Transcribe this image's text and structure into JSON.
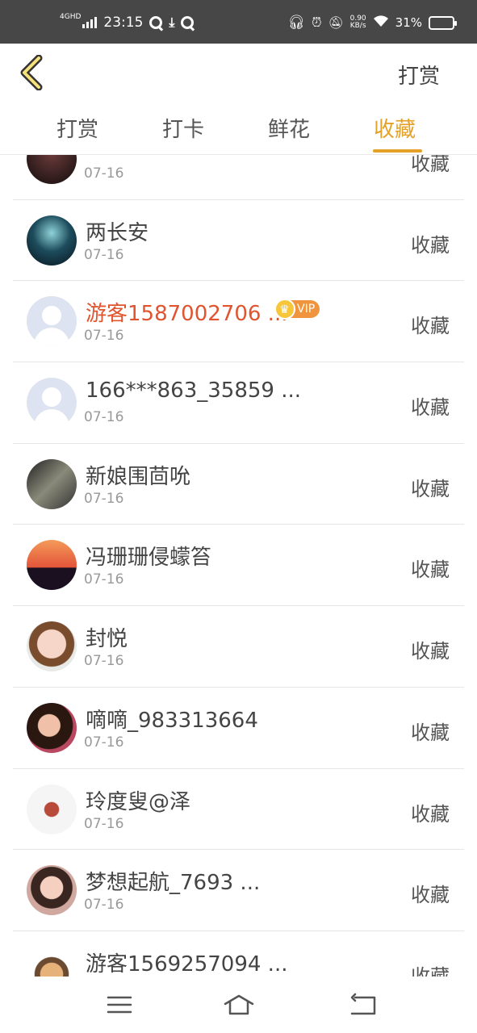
{
  "status_bar": {
    "network": "4GHD",
    "time": "23:15",
    "speed_value": "0.90",
    "speed_unit": "KB/s",
    "battery": "31%",
    "battery_level": 0.31
  },
  "header": {
    "action_label": "打赏"
  },
  "tabs": [
    {
      "label": "打赏"
    },
    {
      "label": "打卡"
    },
    {
      "label": "鲜花"
    },
    {
      "label": "收藏"
    }
  ],
  "active_tab": 3,
  "list": {
    "items": [
      {
        "name": "",
        "date": "07-16",
        "action": "收藏"
      },
      {
        "name": "两长安",
        "date": "07-16",
        "action": "收藏"
      },
      {
        "name": "游客1587002706 ...",
        "date": "07-16",
        "action": "收藏",
        "vip": "VIP"
      },
      {
        "name": "166***863_35859 ...",
        "date": "07-16",
        "action": "收藏"
      },
      {
        "name": "新娘围茴吮",
        "date": "07-16",
        "action": "收藏"
      },
      {
        "name": "冯珊珊侵蠓笞",
        "date": "07-16",
        "action": "收藏"
      },
      {
        "name": "封悦",
        "date": "07-16",
        "action": "收藏"
      },
      {
        "name": "嘀嘀_983313664",
        "date": "07-16",
        "action": "收藏"
      },
      {
        "name": "玲度叟@泽",
        "date": "07-16",
        "action": "收藏"
      },
      {
        "name": "梦想起航_7693 ...",
        "date": "07-16",
        "action": "收藏"
      },
      {
        "name": "游客1569257094 ...",
        "date": "",
        "action": "收藏"
      }
    ]
  },
  "colors": {
    "accent": "#e5a127",
    "vip_name": "#e0542f",
    "status_bar_bg": "#474747"
  }
}
